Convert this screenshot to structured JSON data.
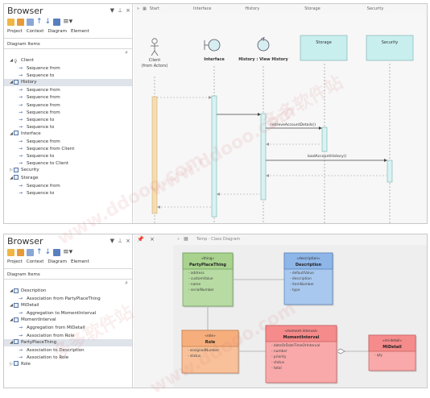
{
  "panel1": {
    "browser": {
      "title": "Browser",
      "controls": [
        "▼",
        "📌",
        "×"
      ],
      "tabs": [
        "Project",
        "Context",
        "Diagram",
        "Element"
      ],
      "section_label": "Diagram Items",
      "tree": [
        {
          "label": "Client",
          "level": 0,
          "kind": "actor",
          "expanded": true
        },
        {
          "label": "Sequence from",
          "level": 1,
          "kind": "out"
        },
        {
          "label": "Sequence to",
          "level": 1,
          "kind": "in"
        },
        {
          "label": "History",
          "level": 0,
          "kind": "class",
          "expanded": true,
          "selected": true
        },
        {
          "label": "Sequence from",
          "level": 1,
          "kind": "out"
        },
        {
          "label": "Sequence from",
          "level": 1,
          "kind": "out"
        },
        {
          "label": "Sequence from",
          "level": 1,
          "kind": "out"
        },
        {
          "label": "Sequence from",
          "level": 1,
          "kind": "out"
        },
        {
          "label": "Sequence to",
          "level": 1,
          "kind": "in"
        },
        {
          "label": "Sequence to",
          "level": 1,
          "kind": "in"
        },
        {
          "label": "Interface",
          "level": 0,
          "kind": "class",
          "expanded": true
        },
        {
          "label": "Sequence from",
          "level": 1,
          "kind": "out"
        },
        {
          "label": "Sequence from Client",
          "level": 1,
          "kind": "out"
        },
        {
          "label": "Sequence to",
          "level": 1,
          "kind": "in"
        },
        {
          "label": "Sequence to Client",
          "level": 1,
          "kind": "in"
        },
        {
          "label": "Security",
          "level": 0,
          "kind": "class",
          "expanded": false
        },
        {
          "label": "Storage",
          "level": 0,
          "kind": "class",
          "expanded": true
        },
        {
          "label": "Sequence from",
          "level": 1,
          "kind": "out"
        },
        {
          "label": "Sequence to",
          "level": 1,
          "kind": "in"
        }
      ]
    },
    "diagram": {
      "header_tabs": [
        "Start",
        "Interface",
        "History",
        "Storage",
        "Security"
      ],
      "lifelines": [
        {
          "name": "Client\n(from Actors)",
          "kind": "actor"
        },
        {
          "name": "Interface",
          "kind": "boundary"
        },
        {
          "name": "History : View History",
          "kind": "control"
        },
        {
          "name": "Storage",
          "kind": "box"
        },
        {
          "name": "Security",
          "kind": "box"
        }
      ],
      "messages": [
        {
          "label": "retrieveAccountDetails()"
        },
        {
          "label": "loadAccountHistory()"
        }
      ]
    }
  },
  "panel2": {
    "browser": {
      "title": "Browser",
      "controls": [
        "▼",
        "📌",
        "×"
      ],
      "tabs": [
        "Project",
        "Context",
        "Diagram",
        "Element"
      ],
      "section_label": "Diagram Items",
      "tree": [
        {
          "label": "Description",
          "level": 0,
          "kind": "class",
          "expanded": true
        },
        {
          "label": "Association from PartyPlaceThing",
          "level": 1,
          "kind": "out"
        },
        {
          "label": "MiDetail",
          "level": 0,
          "kind": "class",
          "expanded": true
        },
        {
          "label": "Aggregation to MomentInterval",
          "level": 1,
          "kind": "out"
        },
        {
          "label": "MomentInterval",
          "level": 0,
          "kind": "class",
          "expanded": true
        },
        {
          "label": "Aggregation from MiDetail",
          "level": 1,
          "kind": "out"
        },
        {
          "label": "Association from Role",
          "level": 1,
          "kind": "out"
        },
        {
          "label": "PartyPlaceThing",
          "level": 0,
          "kind": "class",
          "expanded": true,
          "selected": true
        },
        {
          "label": "Association to Description",
          "level": 1,
          "kind": "out"
        },
        {
          "label": "Association to Role",
          "level": 1,
          "kind": "out"
        },
        {
          "label": "Role",
          "level": 0,
          "kind": "class",
          "expanded": false
        }
      ]
    },
    "diagram": {
      "header": "Temp · Class Diagram",
      "classes": [
        {
          "id": "ppt",
          "stereotype": "«thing»",
          "name": "PartyPlaceThing",
          "attrs": [
            "address",
            "customValue",
            "name",
            "serialNumber"
          ],
          "fill": "#b7dba3",
          "head": "#a9d28f",
          "stroke": "#6a9a55"
        },
        {
          "id": "desc",
          "stereotype": "«description»",
          "name": "Description",
          "attrs": [
            "defaultValue",
            "description",
            "itemNumber",
            "type"
          ],
          "fill": "#a9c8ef",
          "head": "#8fb6e8",
          "stroke": "#4f7cb5"
        },
        {
          "id": "role",
          "stereotype": "«role»",
          "name": "Role",
          "attrs": [
            "assignedNumber",
            "status"
          ],
          "fill": "#f8c199",
          "head": "#f6ae7c",
          "stroke": "#c07a4a"
        },
        {
          "id": "mi",
          "stereotype": "«moment-interval»",
          "name": "MomentInterval",
          "attrs": [
            "dateOrDateTimeOrInterval",
            "number",
            "priority",
            "status",
            "total"
          ],
          "fill": "#f9a9a9",
          "head": "#f58b8b",
          "stroke": "#c45a5a"
        },
        {
          "id": "mid",
          "stereotype": "«mi-detail»",
          "name": "MiDetail",
          "attrs": [
            "qty"
          ],
          "fill": "#f9a9a9",
          "head": "#f58b8b",
          "stroke": "#c45a5a"
        }
      ]
    }
  },
  "colors": {
    "activation": "#d9f2f2",
    "activation_stroke": "#5aa5a5",
    "storage_box": "#c8eeee",
    "client_activation": "#f5ddb0",
    "selection": "#dfe3ea"
  }
}
